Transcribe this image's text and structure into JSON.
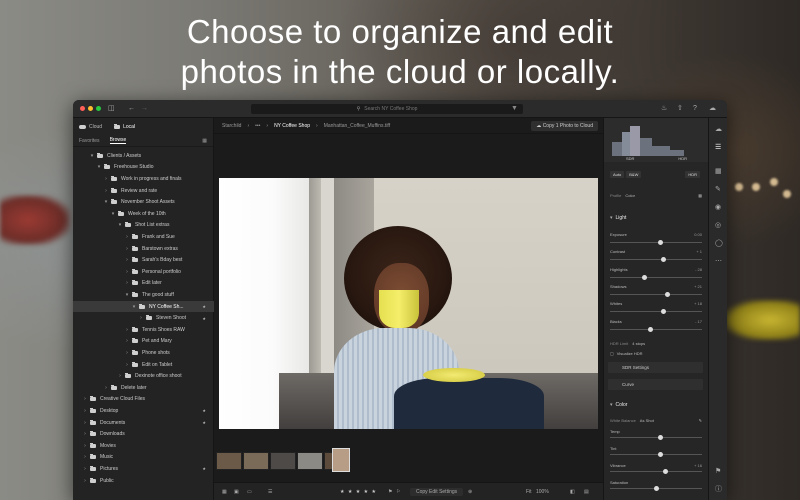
{
  "headline": {
    "line1": "Choose to organize and edit",
    "line2": "photos in the cloud or locally."
  },
  "titlebar": {
    "search_placeholder": "Search NY Coffee Shop"
  },
  "left_panel": {
    "tabs": [
      "Cloud",
      "Local"
    ],
    "active_tab": "Local",
    "subtabs": [
      "Favorites",
      "Browse"
    ],
    "active_subtab": "Browse",
    "tree": [
      {
        "label": "Clients / Assets",
        "level": 1,
        "open": true
      },
      {
        "label": "Freehouse Studio",
        "level": 2,
        "open": true
      },
      {
        "label": "Work in progress and finals",
        "level": 3
      },
      {
        "label": "Review and rate",
        "level": 3
      },
      {
        "label": "November Shoot Assets",
        "level": 3,
        "open": true
      },
      {
        "label": "Week of the 10th",
        "level": 4,
        "open": true
      },
      {
        "label": "Shot List extras",
        "level": 5,
        "open": true
      },
      {
        "label": "Frank and Sue",
        "level": 6
      },
      {
        "label": "Barstown extras",
        "level": 6
      },
      {
        "label": "Sarah's Bday best",
        "level": 6
      },
      {
        "label": "Personal portfolio",
        "level": 6
      },
      {
        "label": "Edit later",
        "level": 6
      },
      {
        "label": "The good stuff",
        "level": 6,
        "open": true
      },
      {
        "label": "NY Coffee Sh...",
        "level": 7,
        "open": true,
        "selected": true,
        "star": true
      },
      {
        "label": "Steven Shoot",
        "level": 8,
        "star": true
      },
      {
        "label": "Tennis Shoes RAW",
        "level": 6
      },
      {
        "label": "Pet and Mary",
        "level": 6
      },
      {
        "label": "Phone shots",
        "level": 6
      },
      {
        "label": "Edit on Tablet",
        "level": 6
      },
      {
        "label": "Dexinote office shoot",
        "level": 5
      },
      {
        "label": "Delete later",
        "level": 3
      },
      {
        "label": "Creative Cloud Files",
        "level": 0
      },
      {
        "label": "Desktop",
        "level": 0,
        "star": true
      },
      {
        "label": "Documents",
        "level": 0,
        "star": true
      },
      {
        "label": "Downloads",
        "level": 0
      },
      {
        "label": "Movies",
        "level": 0
      },
      {
        "label": "Music",
        "level": 0
      },
      {
        "label": "Pictures",
        "level": 0,
        "star": true
      },
      {
        "label": "Public",
        "level": 0
      }
    ]
  },
  "center": {
    "breadcrumb": [
      "Starchild",
      "•••",
      "NY Coffee Shop",
      "Manhattan_Coffee_Muffins.tiff"
    ],
    "copy_button": "Copy 1 Photo to Cloud",
    "bottombar": {
      "rating_stars": "★ ★ ★ ★ ★",
      "copy_edit": "Copy Edit Settings",
      "fit": "Fit",
      "zoom": "100%"
    }
  },
  "right_panel": {
    "histogram_labels": [
      "SDR",
      "HDR"
    ],
    "auto": "Auto",
    "bw": "B&W",
    "hdr": "HDR",
    "profile_label": "Profile",
    "profile_value": "Color",
    "light_section": "Light",
    "sliders": [
      {
        "label": "Exposure",
        "value": "0.00",
        "pos": 0.55
      },
      {
        "label": "Contrast",
        "value": "+ 1",
        "pos": 0.58
      },
      {
        "label": "Highlights",
        "value": "- 28",
        "pos": 0.38
      },
      {
        "label": "Shadows",
        "value": "+ 21",
        "pos": 0.63
      },
      {
        "label": "Whites",
        "value": "+ 18",
        "pos": 0.58
      },
      {
        "label": "Blacks",
        "value": "- 17",
        "pos": 0.44
      }
    ],
    "hdr_limit_label": "HDR Limit",
    "hdr_limit_value": "4 stops",
    "visualize_hdr": "Visualize HDR",
    "sdr_settings": "SDR Settings",
    "curve": "Curve",
    "color_section": "Color",
    "white_balance_label": "White Balance",
    "white_balance_value": "As Shot",
    "color_sliders": [
      {
        "label": "Temp",
        "pos": 0.55
      },
      {
        "label": "Tint",
        "pos": 0.55
      },
      {
        "label": "Vibrance",
        "value": "+ 16",
        "pos": 0.6
      },
      {
        "label": "Saturation",
        "pos": 0.5
      }
    ]
  }
}
